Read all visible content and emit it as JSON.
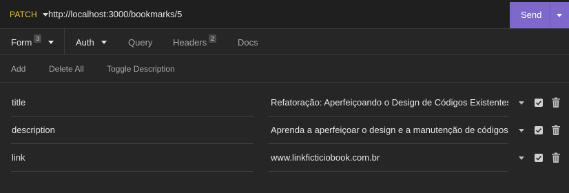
{
  "request": {
    "method": "PATCH",
    "url": "http://localhost:3000/bookmarks/5",
    "send_label": "Send"
  },
  "tabs": {
    "form": {
      "label": "Form",
      "badge": "3"
    },
    "auth": {
      "label": "Auth"
    },
    "query": {
      "label": "Query"
    },
    "headers": {
      "label": "Headers",
      "badge": "2"
    },
    "docs": {
      "label": "Docs"
    }
  },
  "actions": {
    "add": "Add",
    "delete_all": "Delete All",
    "toggle_description": "Toggle Description"
  },
  "fields": [
    {
      "name": "title",
      "value": "Refatoração: Aperfeiçoando o Design de Códigos Existentes",
      "enabled": true
    },
    {
      "name": "description",
      "value": "Aprenda a aperfeiçoar o design e a manutenção de códigos",
      "enabled": true
    },
    {
      "name": "link",
      "value": "www.linkficticiobook.com.br",
      "enabled": true
    }
  ],
  "colors": {
    "method": "#e8c33e",
    "send_button": "#7d69cb",
    "background": "#262626"
  },
  "icons": {
    "method_dropdown": "chevron-down-icon",
    "send_dropdown": "chevron-down-icon",
    "row_dropdown": "chevron-down-icon",
    "row_enabled": "checkbox-checked-icon",
    "row_delete": "trash-icon"
  }
}
